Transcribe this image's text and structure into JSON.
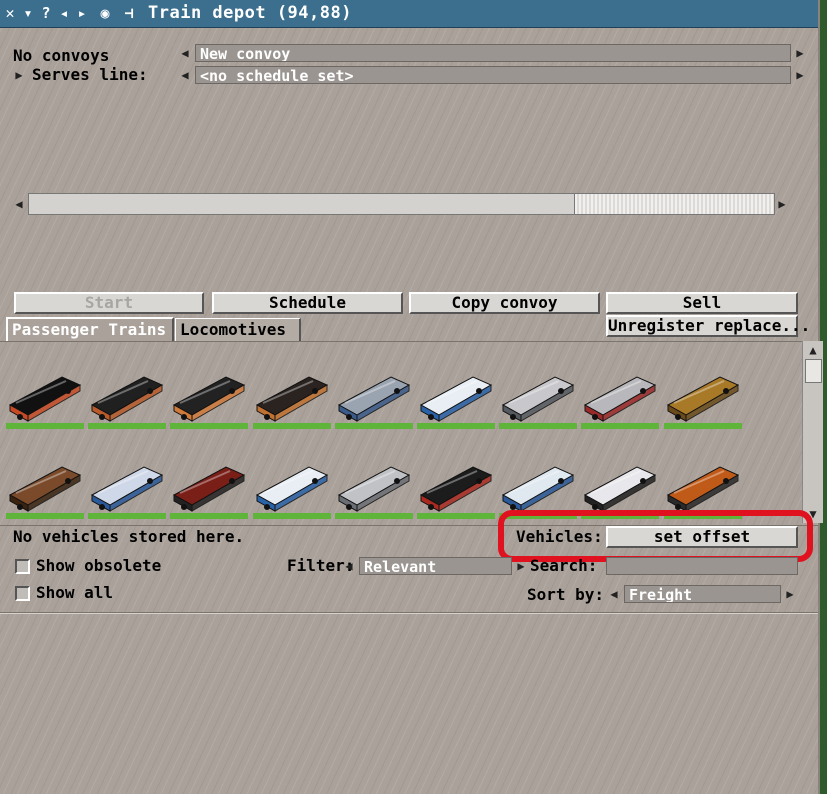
{
  "window": {
    "title": "Train depot (94,88)",
    "title_icons": [
      "close-icon",
      "collapse-icon",
      "help-icon",
      "prev-icon",
      "next-icon",
      "eye-icon",
      "pin-icon"
    ]
  },
  "convoy": {
    "count_label": "No convoys",
    "convoy_select": "New convoy",
    "serves_line_label": "Serves line:",
    "line_select": "<no schedule set>"
  },
  "buttons": {
    "start": "Start",
    "schedule": "Schedule",
    "copy_convoy": "Copy convoy",
    "sell": "Sell",
    "unregister_replace": "Unregister replace..."
  },
  "tabs": [
    {
      "label": "Passenger Trains",
      "active": true
    },
    {
      "label": "Locomotives",
      "active": false
    }
  ],
  "vehicle_rows": [
    [
      {
        "name": "steam-locomotive-black-red",
        "colors": [
          "#111111",
          "#c54a25"
        ]
      },
      {
        "name": "diesel-locomotive-black",
        "colors": [
          "#202020",
          "#b85a2a"
        ]
      },
      {
        "name": "coach-black-orange",
        "colors": [
          "#222222",
          "#d07a3a"
        ]
      },
      {
        "name": "boxcar-dark",
        "colors": [
          "#2a2320",
          "#c07030"
        ]
      },
      {
        "name": "coach-blue-grey",
        "colors": [
          "#9aa4b0",
          "#3a5a8a"
        ]
      },
      {
        "name": "railcar-white-blue",
        "colors": [
          "#e8eef4",
          "#2a62a8"
        ]
      },
      {
        "name": "railcar-silver",
        "colors": [
          "#c8c8cc",
          "#555a60"
        ]
      },
      {
        "name": "coach-silver-red",
        "colors": [
          "#b8b8bc",
          "#9a2a2a"
        ]
      },
      {
        "name": "caboose-yellow",
        "colors": [
          "#a87a28",
          "#6a4a1a"
        ]
      }
    ],
    [
      {
        "name": "caboose-brown",
        "colors": [
          "#7a4a2a",
          "#3a2410"
        ]
      },
      {
        "name": "railcar-blue-white",
        "colors": [
          "#cfd8e8",
          "#2a5a9a"
        ]
      },
      {
        "name": "steam-locomotive-red",
        "colors": [
          "#7a1e18",
          "#222222"
        ]
      },
      {
        "name": "coach-white-blue",
        "colors": [
          "#e8eef4",
          "#2a62a8"
        ]
      },
      {
        "name": "coach-silver",
        "colors": [
          "#c0c2c6",
          "#6a6e74"
        ]
      },
      {
        "name": "locomotive-black-red",
        "colors": [
          "#1c1c1c",
          "#a82a20"
        ]
      },
      {
        "name": "railcar-white-blue-2",
        "colors": [
          "#e0e8f0",
          "#2a5a9a"
        ]
      },
      {
        "name": "coach-white-black",
        "colors": [
          "#e8e8ec",
          "#222222"
        ]
      },
      {
        "name": "caboose-orange",
        "colors": [
          "#c05a18",
          "#2a2a2a"
        ]
      }
    ]
  ],
  "storage": {
    "status": "No vehicles stored here.",
    "vehicles_label": "Vehicles:",
    "set_offset_button": "set offset"
  },
  "filters": {
    "show_obsolete_label": "Show obsolete",
    "show_obsolete_checked": false,
    "show_all_label": "Show all",
    "show_all_checked": false,
    "filter_label": "Filter:",
    "filter_value": "Relevant",
    "search_label": "Search:",
    "search_value": "",
    "sort_label": "Sort by:",
    "sort_value": "Freight"
  },
  "colors": {
    "titlebar": "#3c6f8e",
    "highlight": "#e11220",
    "availability_bar": "#5fb43a"
  }
}
